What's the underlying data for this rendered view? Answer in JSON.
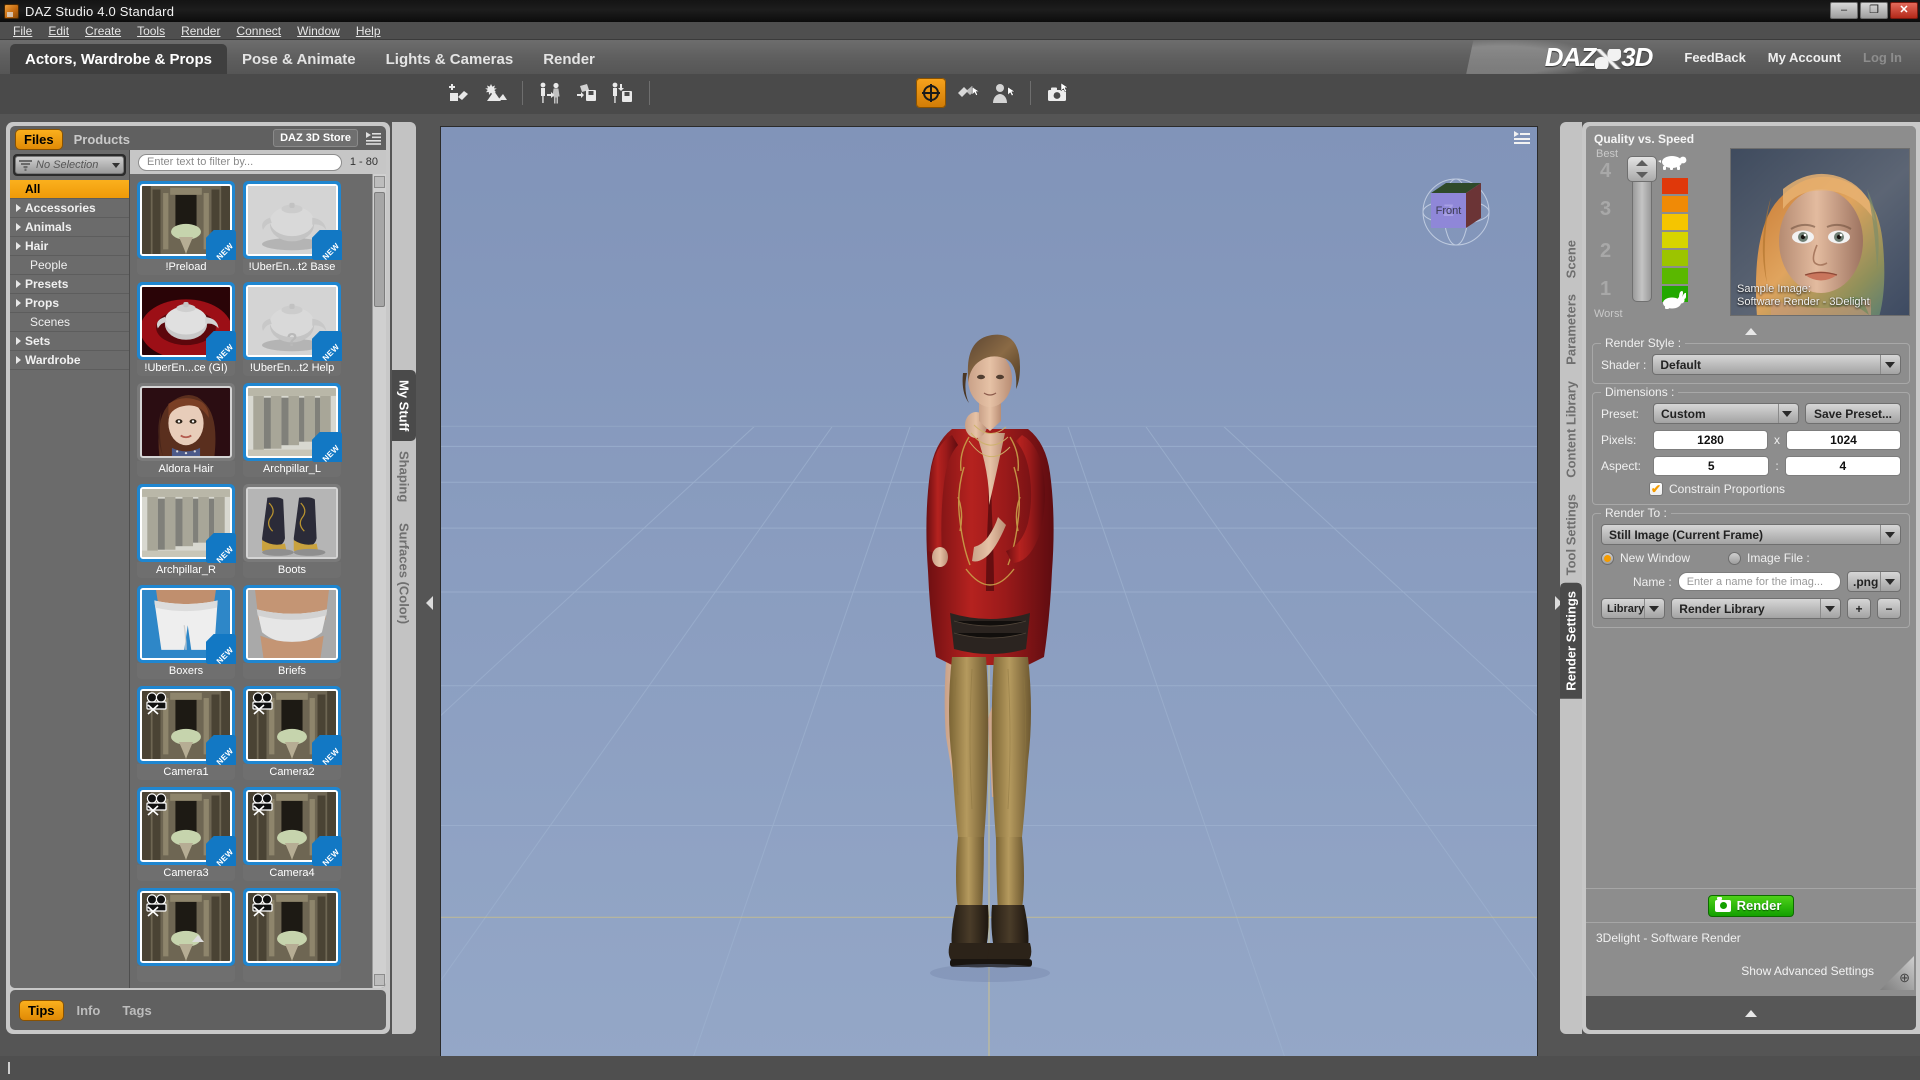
{
  "window": {
    "title": "DAZ Studio 4.0 Standard",
    "app_icon": "daz-app-icon",
    "minimize": "–",
    "maximize": "❐",
    "close": "✕"
  },
  "menubar": {
    "items": [
      "File",
      "Edit",
      "Create",
      "Tools",
      "Render",
      "Connect",
      "Window",
      "Help"
    ]
  },
  "activity_tabs": [
    {
      "label": "Actors, Wardrobe & Props",
      "active": true
    },
    {
      "label": "Pose & Animate",
      "active": false
    },
    {
      "label": "Lights & Cameras",
      "active": false
    },
    {
      "label": "Render",
      "active": false
    }
  ],
  "brand": {
    "logo": "DAZ 3D",
    "links": [
      {
        "label": "FeedBack",
        "dim": false
      },
      {
        "label": "My Account",
        "dim": false
      },
      {
        "label": "Log In",
        "dim": true
      }
    ]
  },
  "toolbar": {
    "left_group": [
      {
        "icon": "add-primitive-icon",
        "active": false
      },
      {
        "icon": "add-environment-icon",
        "active": false
      },
      {
        "icon": "transfer-figure-icon",
        "active": false
      },
      {
        "icon": "save-shape-icon",
        "active": false
      },
      {
        "icon": "save-figure-icon",
        "active": false
      }
    ],
    "center_group": [
      {
        "icon": "universal-tool-icon",
        "active": true
      },
      {
        "icon": "surface-selection-icon",
        "active": false
      },
      {
        "icon": "node-selection-icon",
        "active": false
      },
      {
        "icon": "camera-tool-icon",
        "active": false
      }
    ]
  },
  "left_panel": {
    "tabs": [
      {
        "label": "Files",
        "active": true
      },
      {
        "label": "Products",
        "active": false
      }
    ],
    "store_button": "DAZ 3D Store",
    "options_icon": "panel-options-icon",
    "selection": {
      "icon": "filter-funnel-icon",
      "value": "No Selection"
    },
    "categories": [
      {
        "label": "All",
        "expandable": false,
        "selected": true
      },
      {
        "label": "Accessories",
        "expandable": true,
        "selected": false
      },
      {
        "label": "Animals",
        "expandable": true,
        "selected": false
      },
      {
        "label": "Hair",
        "expandable": true,
        "selected": false
      },
      {
        "label": "People",
        "expandable": false,
        "selected": false
      },
      {
        "label": "Presets",
        "expandable": true,
        "selected": false
      },
      {
        "label": "Props",
        "expandable": true,
        "selected": false
      },
      {
        "label": "Scenes",
        "expandable": false,
        "selected": false
      },
      {
        "label": "Sets",
        "expandable": true,
        "selected": false
      },
      {
        "label": "Wardrobe",
        "expandable": true,
        "selected": false
      }
    ],
    "filter": {
      "placeholder": "Enter text to filter by...",
      "value": ""
    },
    "range_count": "1 - 80",
    "assets": [
      {
        "label": "!Preload",
        "new": true,
        "selected": true,
        "thumb": "set-hall",
        "overlay": ""
      },
      {
        "label": "!UberEn...t2 Base",
        "new": true,
        "selected": true,
        "thumb": "teapot-gray",
        "overlay": ""
      },
      {
        "label": "!UberEn...ce (GI)",
        "new": true,
        "selected": true,
        "thumb": "teapot-red",
        "overlay": ""
      },
      {
        "label": "!UberEn...t2 Help",
        "new": true,
        "selected": true,
        "thumb": "teapot-gray",
        "overlay": "?"
      },
      {
        "label": "Aldora Hair",
        "new": false,
        "selected": false,
        "thumb": "hair-face",
        "overlay": ""
      },
      {
        "label": "Archpillar_L",
        "new": true,
        "selected": true,
        "thumb": "pillars",
        "overlay": ""
      },
      {
        "label": "Archpillar_R",
        "new": true,
        "selected": true,
        "thumb": "pillars",
        "overlay": ""
      },
      {
        "label": "Boots",
        "new": false,
        "selected": false,
        "thumb": "boots",
        "overlay": ""
      },
      {
        "label": "Boxers",
        "new": true,
        "selected": true,
        "thumb": "boxers",
        "overlay": ""
      },
      {
        "label": "Briefs",
        "new": false,
        "selected": true,
        "thumb": "briefs",
        "overlay": ""
      },
      {
        "label": "Camera1",
        "new": true,
        "selected": true,
        "thumb": "set-hall",
        "overlay": "camera"
      },
      {
        "label": "Camera2",
        "new": true,
        "selected": true,
        "thumb": "set-hall",
        "overlay": "camera"
      },
      {
        "label": "Camera3",
        "new": true,
        "selected": true,
        "thumb": "set-hall",
        "overlay": "camera"
      },
      {
        "label": "Camera4",
        "new": true,
        "selected": true,
        "thumb": "set-hall",
        "overlay": "camera"
      },
      {
        "label": "",
        "new": false,
        "selected": true,
        "thumb": "set-hall",
        "overlay": "camera"
      },
      {
        "label": "",
        "new": false,
        "selected": true,
        "thumb": "set-hall",
        "overlay": "camera"
      }
    ],
    "bottom_tabs": [
      {
        "label": "Tips",
        "active": true
      },
      {
        "label": "Info",
        "active": false
      },
      {
        "label": "Tags",
        "active": false
      }
    ]
  },
  "left_vertical_tabs": [
    {
      "label": "My Stuff",
      "active": true
    },
    {
      "label": "Shaping",
      "active": false
    },
    {
      "label": "Surfaces (Color)",
      "active": false
    }
  ],
  "viewport": {
    "menu_icon": "viewport-menu-icon",
    "nav_cube_label": "Front",
    "nav_cube_axis": "Z"
  },
  "right_vertical_tabs": [
    {
      "label": "Scene",
      "active": false
    },
    {
      "label": "Parameters",
      "active": false
    },
    {
      "label": "Content Library",
      "active": false
    },
    {
      "label": "Tool Settings",
      "active": false
    },
    {
      "label": "Render Settings",
      "active": true
    }
  ],
  "render_settings": {
    "quality": {
      "title": "Quality vs. Speed",
      "best_label": "Best",
      "worst_label": "Worst",
      "ticks": [
        "4",
        "3",
        "2",
        "1"
      ],
      "value": 4,
      "slow_icon": "turtle-icon",
      "fast_icon": "rabbit-icon",
      "ramp_colors": [
        "#e0380a",
        "#f08a06",
        "#f5c500",
        "#d7d500",
        "#9cc400",
        "#5ab800",
        "#22a800"
      ]
    },
    "preview": {
      "caption_line1": "Sample Image:",
      "caption_line2": "Software Render - 3Delight"
    },
    "render_style": {
      "group_title": "Render Style :",
      "shader_label": "Shader :",
      "shader_value": "Default"
    },
    "dimensions": {
      "group_title": "Dimensions :",
      "preset_label": "Preset:",
      "preset_value": "Custom",
      "save_preset_button": "Save Preset...",
      "pixels_label": "Pixels:",
      "pixels_width": "1280",
      "pixels_height": "1024",
      "pixels_separator": "x",
      "aspect_label": "Aspect:",
      "aspect_w": "5",
      "aspect_h": "4",
      "aspect_separator": ":",
      "constrain_label": "Constrain Proportions",
      "constrain_checked": true,
      "check_glyph": "✔"
    },
    "render_to": {
      "group_title": "Render To :",
      "target_value": "Still Image (Current Frame)",
      "new_window_label": "New Window",
      "new_window_selected": true,
      "image_file_label": "Image File :",
      "image_file_selected": false,
      "name_label": "Name :",
      "name_placeholder": "Enter a name for the imag...",
      "format_value": ".png",
      "library_button": "Library",
      "library_value": "Render Library",
      "add_button": "+",
      "remove_button": "−"
    },
    "render_button": "Render",
    "render_button_color": "#13a000",
    "engine_status": "3Delight - Software Render",
    "advanced_link": "Show Advanced Settings",
    "magnifier_icon": "magnifier-plus-icon"
  },
  "colors": {
    "accent": "#f5a30c",
    "selection_blue": "#1f86d0",
    "viewport_bg": "#8ca0c2",
    "panel_bg": "#8d8d8d"
  }
}
